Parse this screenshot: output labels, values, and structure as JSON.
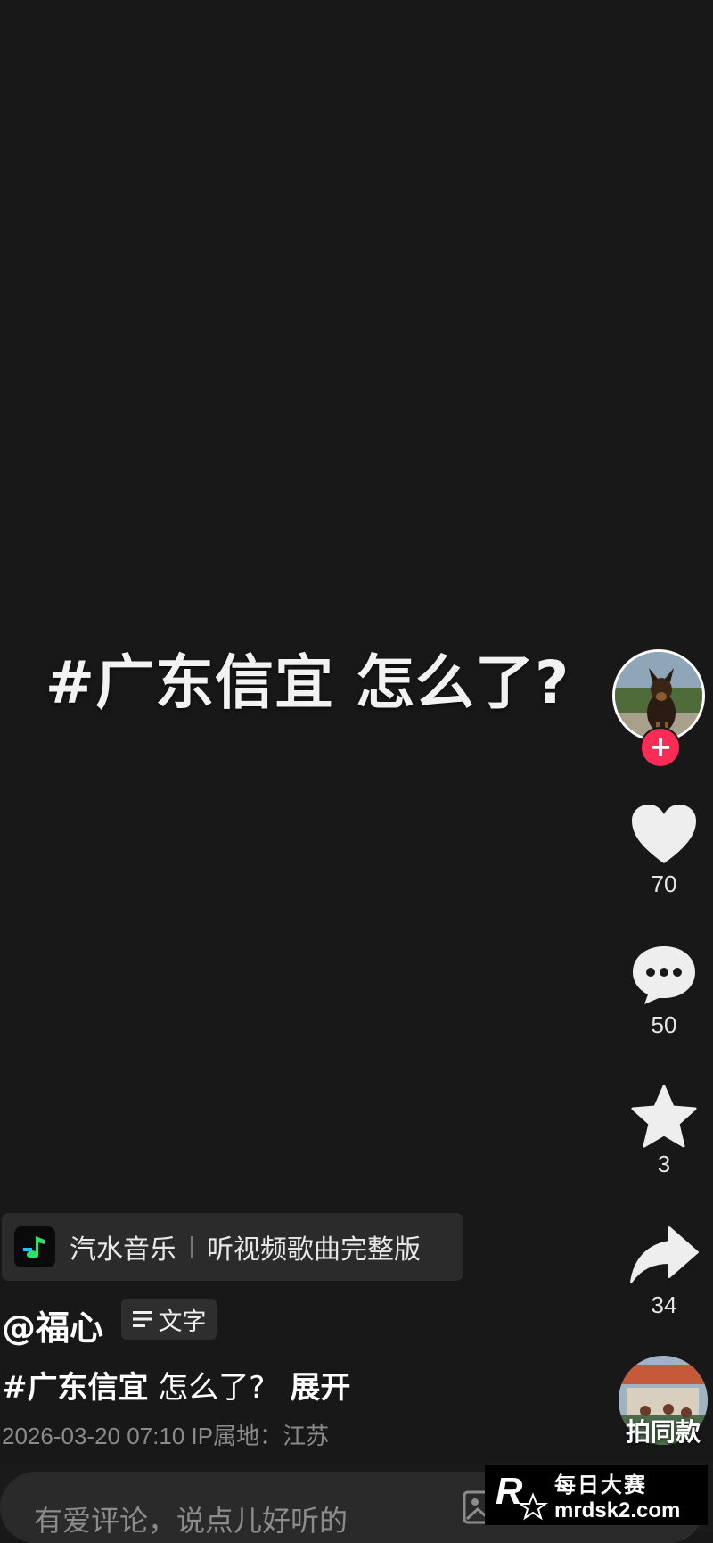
{
  "video": {
    "overlay_text": "#广东信宜 怎么了?"
  },
  "rail": {
    "follow_symbol": "+",
    "like_count": "70",
    "comment_count": "50",
    "favorite_count": "3",
    "share_count": "34",
    "same_style_label": "拍同款"
  },
  "music": {
    "app_name": "汽水音乐",
    "promo_text": "听视频歌曲完整版"
  },
  "post": {
    "author": "@福心",
    "text_chip_label": "文字",
    "hashtag": "#广东信宜",
    "desc_rest": " 怎么了?",
    "expand_label": "展开",
    "meta": "2026-03-20 07:10  IP属地：江苏"
  },
  "comment": {
    "placeholder": "有爱评论，说点儿好听的"
  },
  "watermark": {
    "cn": "每日大赛",
    "en": "mrdsk2.com"
  },
  "colors": {
    "background": "#181818",
    "follow_accent": "#fe2c55",
    "icon": "#eeeeee",
    "secondary_text": "#8a8a8a"
  },
  "icons": [
    "heart-icon",
    "comment-bubble-icon",
    "star-icon",
    "share-arrow-icon",
    "image-icon",
    "at-icon",
    "emoji-icon",
    "music-app-logo"
  ]
}
